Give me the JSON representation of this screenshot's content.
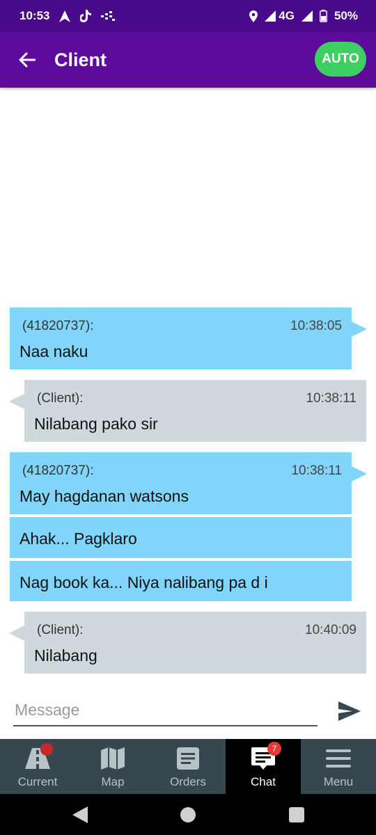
{
  "status_bar": {
    "time": "10:53",
    "network": "4G",
    "battery": "50%",
    "icons": [
      "navigation-arrow-icon",
      "tiktok-icon",
      "signal-dots-icon",
      "location-pin-icon",
      "signal-icon",
      "battery-icon"
    ]
  },
  "header": {
    "title": "Client",
    "auto_label": "AUTO"
  },
  "messages": [
    {
      "direction": "outgoing",
      "sender": "(41820737):",
      "time": "10:38:05",
      "lines": [
        "Naa naku"
      ]
    },
    {
      "direction": "incoming",
      "sender": "(Client):",
      "time": "10:38:11",
      "lines": [
        "Nilabang pako sir"
      ]
    },
    {
      "direction": "outgoing",
      "sender": "(41820737):",
      "time": "10:38:11",
      "lines": [
        "May hagdanan watsons",
        "Ahak... Pagklaro",
        "Nag book ka... Niya nalibang pa d i"
      ]
    },
    {
      "direction": "incoming",
      "sender": "(Client):",
      "time": "10:40:09",
      "lines": [
        "Nilabang"
      ]
    }
  ],
  "input": {
    "placeholder": "Message",
    "value": ""
  },
  "bottom_nav": {
    "items": [
      {
        "label": "Current",
        "icon": "road-icon"
      },
      {
        "label": "Map",
        "icon": "map-icon"
      },
      {
        "label": "Orders",
        "icon": "orders-icon"
      },
      {
        "label": "Chat",
        "icon": "chat-icon",
        "badge": "7"
      },
      {
        "label": "Menu",
        "icon": "menu-icon"
      }
    ],
    "active": "Chat"
  },
  "colors": {
    "status_bar": "#4a0a8c",
    "app_bar": "#5e0b9c",
    "auto_button": "#3ecf63",
    "outgoing_bubble": "#81d4fa",
    "incoming_bubble": "#cfd8dc",
    "bottom_nav": "#37474f"
  }
}
